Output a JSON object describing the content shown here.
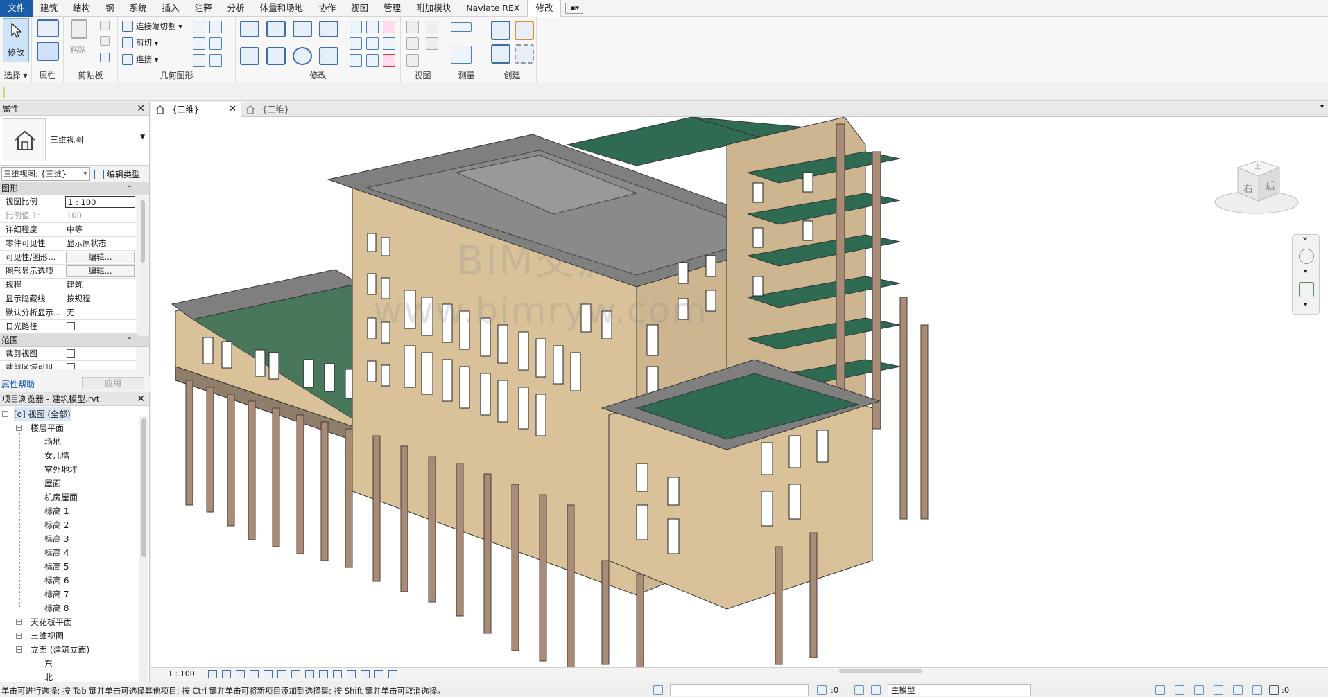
{
  "menu": {
    "tabs": [
      "文件",
      "建筑",
      "结构",
      "钢",
      "系统",
      "插入",
      "注释",
      "分析",
      "体量和场地",
      "协作",
      "视图",
      "管理",
      "附加模块",
      "Naviate REX",
      "修改"
    ],
    "active_tab": "修改"
  },
  "ribbon": {
    "modify_label": "修改",
    "paste_label": "粘贴",
    "cut_join_label": "连接端切割",
    "cut_label": "剪切",
    "join_label": "连接",
    "panels": {
      "select": "选择",
      "properties": "属性",
      "clipboard": "剪贴板",
      "geometry": "几何图形",
      "modify": "修改",
      "view": "视图",
      "measure": "测量",
      "create": "创建"
    }
  },
  "properties": {
    "title": "属性",
    "type_name": "三维视图",
    "selector_value": "三维视图: {三维}",
    "edit_type": "编辑类型",
    "groups": {
      "graphics": "图形",
      "extents": "范围"
    },
    "rows": [
      {
        "key": "视图比例",
        "value": "1 : 100"
      },
      {
        "key": "比例值 1:",
        "value": "100"
      },
      {
        "key": "详细程度",
        "value": "中等"
      },
      {
        "key": "零件可见性",
        "value": "显示原状态"
      },
      {
        "key": "可见性/图形...",
        "value": "编辑..."
      },
      {
        "key": "图形显示选项",
        "value": "编辑..."
      },
      {
        "key": "规程",
        "value": "建筑"
      },
      {
        "key": "显示隐藏线",
        "value": "按规程"
      },
      {
        "key": "默认分析显示...",
        "value": "无"
      },
      {
        "key": "日光路径",
        "value": ""
      }
    ],
    "extent_rows": [
      {
        "key": "裁剪视图",
        "value": ""
      },
      {
        "key": "裁剪区域可见",
        "value": ""
      }
    ],
    "help_link": "属性帮助",
    "apply": "应用"
  },
  "browser": {
    "title": "项目浏览器 - 建筑模型.rvt",
    "root": "视图 (全部)",
    "floor_plans": "楼层平面",
    "floor_plan_items": [
      "场地",
      "女儿墙",
      "室外地坪",
      "屋面",
      "机房屋面",
      "标高 1",
      "标高 2",
      "标高 3",
      "标高 4",
      "标高 5",
      "标高 6",
      "标高 7",
      "标高 8"
    ],
    "ceiling_plans": "天花板平面",
    "views_3d": "三维视图",
    "elevations": "立面 (建筑立面)",
    "elevation_items": [
      "东",
      "北"
    ]
  },
  "view": {
    "tabs": [
      "{三维}",
      "{三维}"
    ],
    "scale": "1 : 100",
    "viewcube_faces": [
      "右",
      "后",
      "上"
    ],
    "watermark_line1": "BIM交流网",
    "watermark_line2": "www.bimryw.com"
  },
  "status": {
    "message": "单击可进行选择; 按 Tab 键并单击可选择其他项目; 按 Ctrl 键并单击可将新项目添加到选择集; 按 Shift 键并单击可取消选择。",
    "count_left": ":0",
    "model": "主模型",
    "count_right": ":0"
  },
  "colors": {
    "file_tab": "#1b5ca8",
    "facade": "#d9c29a",
    "roof_green": "#2f6a52",
    "roof_grey": "#7f7f7f",
    "column": "#a88c78"
  }
}
